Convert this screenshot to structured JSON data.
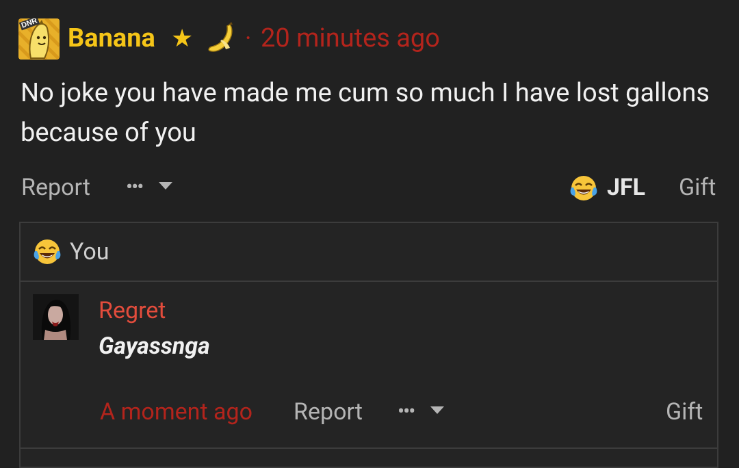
{
  "comment": {
    "username": "Banana",
    "separator": "·",
    "timestamp": "20 minutes ago",
    "text": "No joke you have made me cum so much I have lost gallons because of you",
    "avatar_label": "DNR",
    "badges": [
      "star-icon",
      "banana-icon"
    ],
    "actions": {
      "report_label": "Report",
      "more_label": "•••",
      "reaction_label": "JFL",
      "gift_label": "Gift"
    },
    "reaction_icon": "tears-of-joy-icon"
  },
  "reply_box": {
    "reaction_row": {
      "icon": "tears-of-joy-icon",
      "label": "You"
    },
    "reply": {
      "username": "Regret",
      "text": "Gayassnga",
      "timestamp": "A moment ago",
      "report_label": "Report",
      "more_label": "•••",
      "gift_label": "Gift"
    }
  },
  "colors": {
    "background": "#212121",
    "username_gold": "#f5c518",
    "timestamp_red": "#b3241c",
    "reply_user_red": "#e24c3c",
    "muted_text": "#b5b5b5",
    "border": "#3c3c3c"
  }
}
